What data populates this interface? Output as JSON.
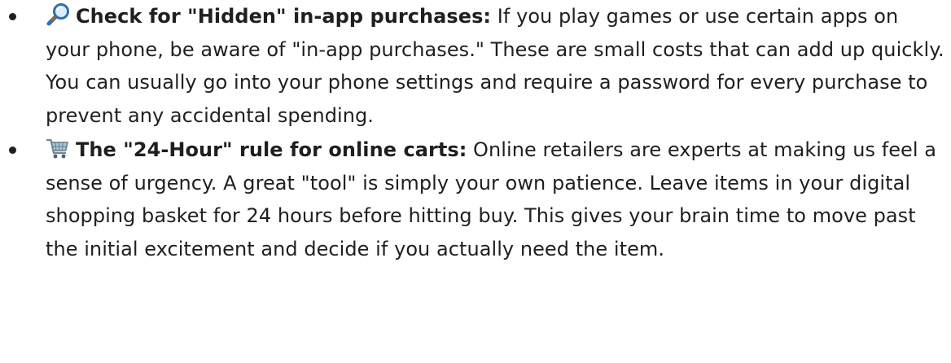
{
  "tips": [
    {
      "icon": "magnifier-icon",
      "heading": "Check for \"Hidden\" in-app purchases:",
      "body": " If you play games or use certain apps on your phone, be aware of \"in-app purchases.\" These are small costs that can add up quickly. You can usually go into your phone settings and require a password for every purchase to prevent any accidental spending."
    },
    {
      "icon": "shopping-cart-icon",
      "heading": "The \"24-Hour\" rule for online carts:",
      "body": " Online retailers are experts at making us feel a sense of urgency. A great \"tool\" is simply your own patience. Leave items in your digital shopping basket for 24 hours before hitting buy. This gives your brain time to move past the initial excitement and decide if you actually need the item."
    }
  ]
}
